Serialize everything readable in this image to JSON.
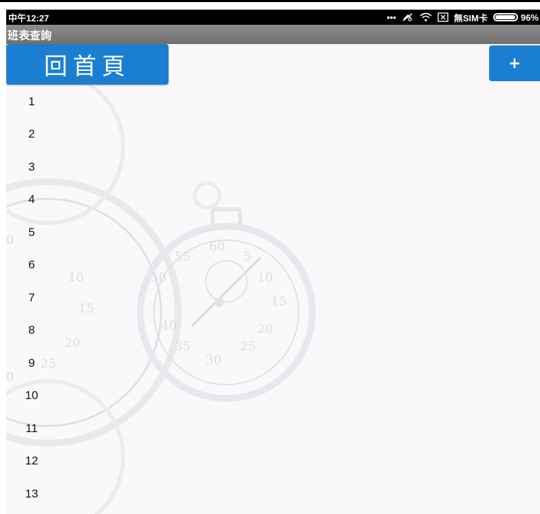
{
  "status_bar": {
    "time": "中午12:27",
    "icons": [
      "more-dots-icon",
      "mute-icon",
      "wifi-icon",
      "no-sim-icon"
    ],
    "sim_text": "無SIM卡",
    "battery_level": 0.96,
    "battery_text": "96%"
  },
  "title_bar": {
    "title": "班表查詢"
  },
  "toolbar": {
    "home_label": "回首頁",
    "add_label": "+"
  },
  "rows": [
    "1",
    "2",
    "3",
    "4",
    "5",
    "6",
    "7",
    "8",
    "9",
    "10",
    "11",
    "12",
    "13"
  ],
  "colors": {
    "accent": "#1b7fd1",
    "title_bar": "#7a7a7a",
    "background": "#fbf8fb"
  }
}
